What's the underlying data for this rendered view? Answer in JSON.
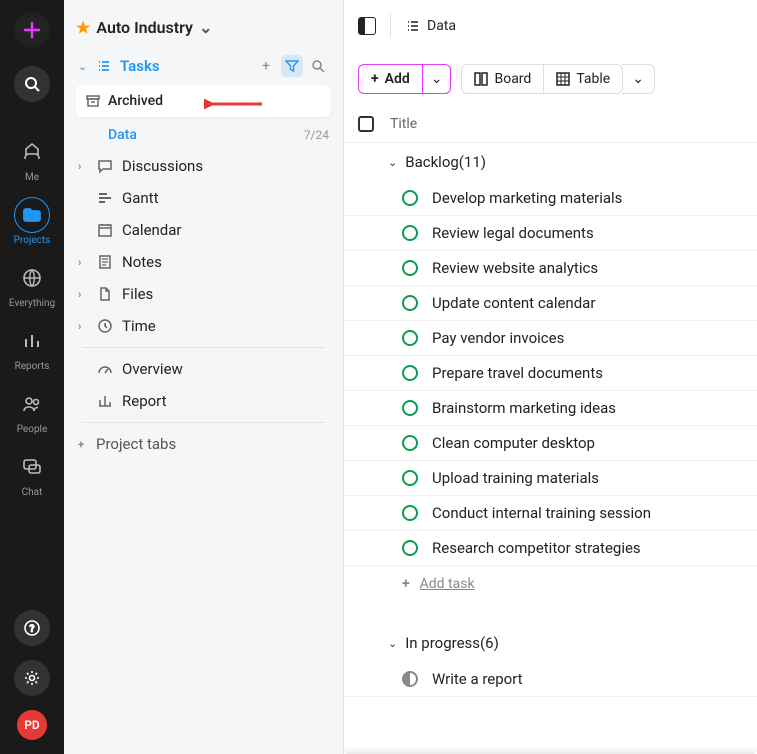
{
  "nav": {
    "items": [
      {
        "name": "me",
        "label": "Me"
      },
      {
        "name": "projects",
        "label": "Projects",
        "active": true
      },
      {
        "name": "everything",
        "label": "Everything"
      },
      {
        "name": "reports",
        "label": "Reports"
      },
      {
        "name": "people",
        "label": "People"
      },
      {
        "name": "chat",
        "label": "Chat"
      }
    ],
    "avatar": "PD"
  },
  "sidebar": {
    "title": "Auto Industry",
    "tasks_label": "Tasks",
    "archived_label": "Archived",
    "data_label": "Data",
    "data_count": "7/24",
    "items": [
      {
        "name": "discussions",
        "label": "Discussions",
        "caret": true
      },
      {
        "name": "gantt",
        "label": "Gantt",
        "caret": false
      },
      {
        "name": "calendar",
        "label": "Calendar",
        "caret": false
      },
      {
        "name": "notes",
        "label": "Notes",
        "caret": true
      },
      {
        "name": "files",
        "label": "Files",
        "caret": true
      },
      {
        "name": "time",
        "label": "Time",
        "caret": true
      }
    ],
    "overview_label": "Overview",
    "report_label": "Report",
    "project_tabs_label": "Project tabs"
  },
  "main": {
    "top_data_label": "Data",
    "add_label": "Add",
    "board_label": "Board",
    "table_label": "Table",
    "title_header": "Title",
    "groups": [
      {
        "name": "Backlog",
        "count": 11,
        "tasks": [
          "Develop marketing materials",
          "Review legal documents",
          "Review website analytics",
          "Update content calendar",
          "Pay vendor invoices",
          "Prepare travel documents",
          "Brainstorm marketing ideas",
          "Clean computer desktop",
          "Upload training materials",
          "Conduct internal training session",
          "Research competitor strategies"
        ]
      },
      {
        "name": "In progress",
        "count": 6,
        "tasks": [
          "Write a report"
        ]
      }
    ],
    "add_task_label": "Add task"
  }
}
